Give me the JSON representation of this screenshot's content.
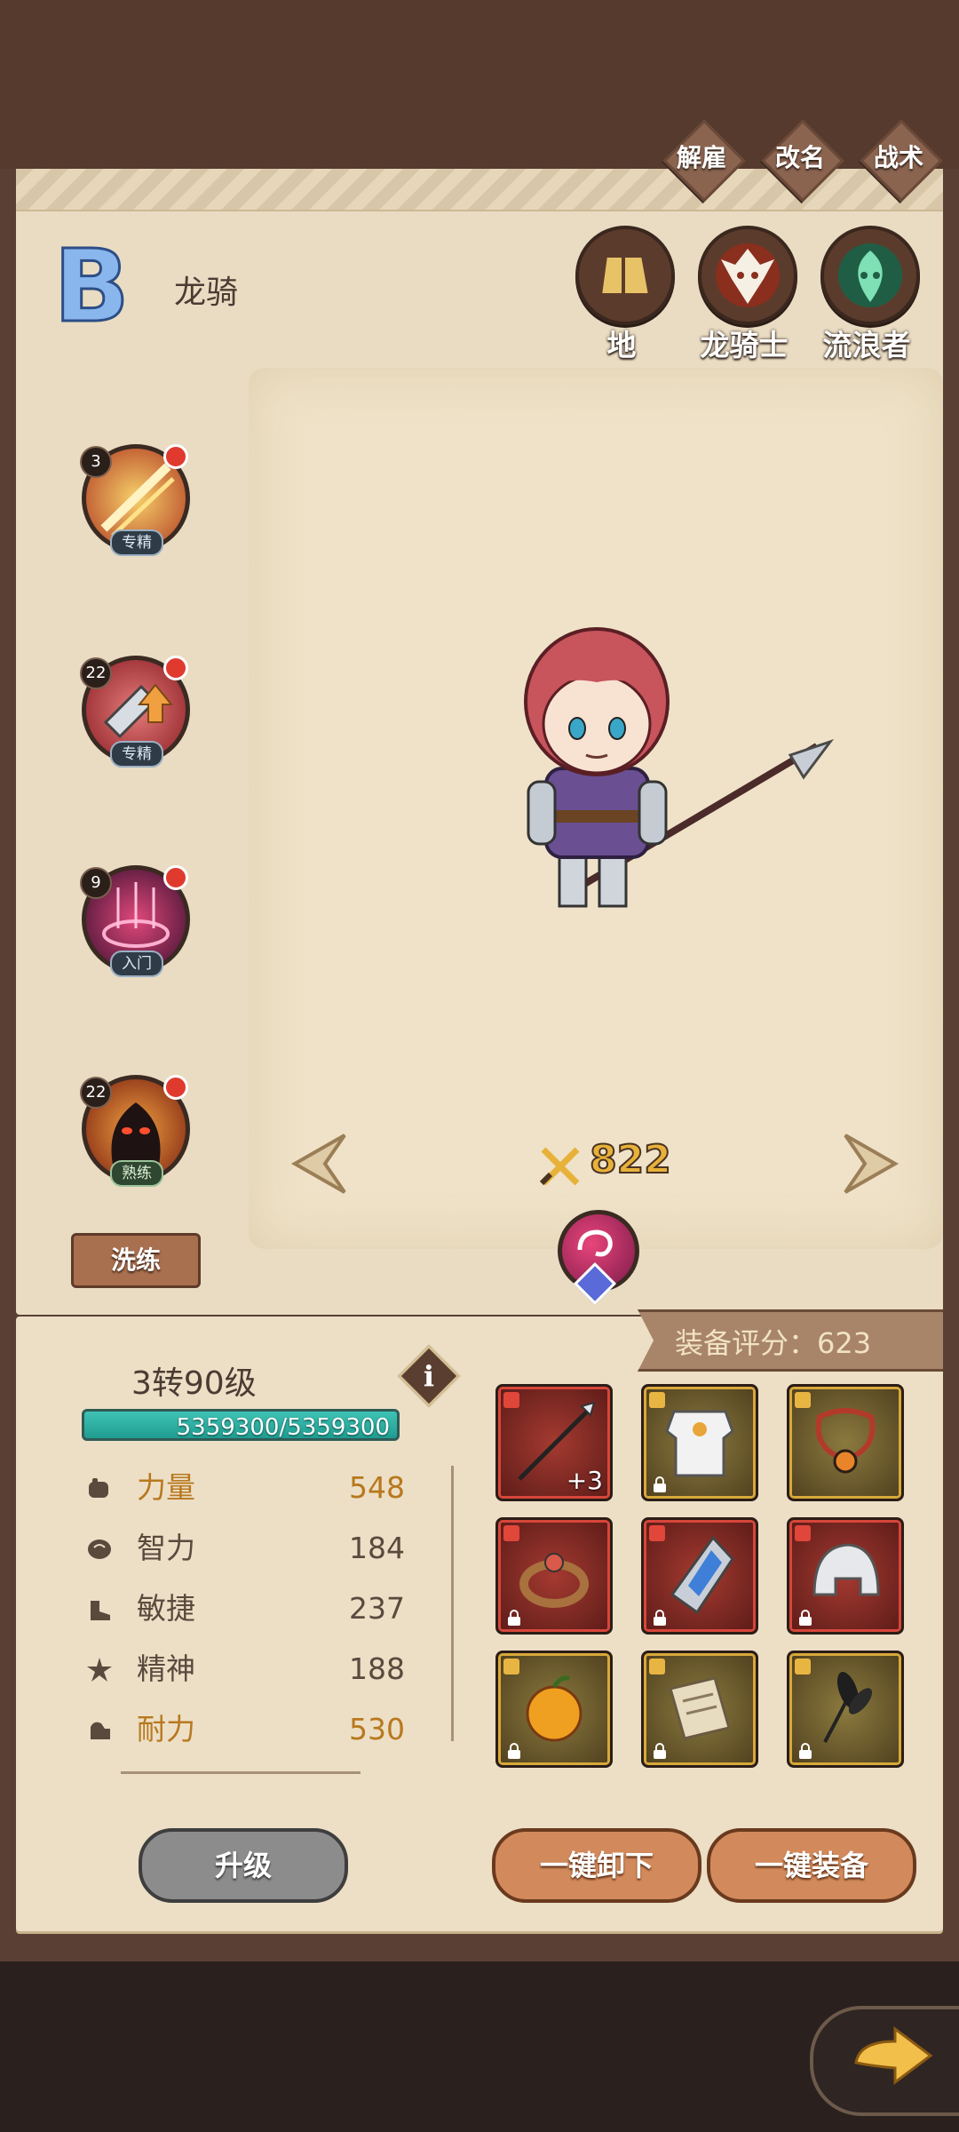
{
  "top_buttons": [
    "解雇",
    "改名",
    "战术"
  ],
  "hero": {
    "rank": "B",
    "name": "龙骑"
  },
  "classes": [
    {
      "label": "地",
      "icon": "earth-element-icon"
    },
    {
      "label": "龙骑士",
      "icon": "dragon-knight-icon"
    },
    {
      "label": "流浪者",
      "icon": "wanderer-icon"
    }
  ],
  "skills": [
    {
      "level": "3",
      "tag": "专精",
      "icon": "slash-skill-icon"
    },
    {
      "level": "22",
      "tag": "专精",
      "icon": "sword-upgrade-skill-icon"
    },
    {
      "level": "9",
      "tag": "入门",
      "icon": "magic-circle-skill-icon"
    },
    {
      "level": "22",
      "tag": "熟练",
      "icon": "fire-demon-skill-icon"
    }
  ],
  "refine_label": "洗练",
  "power": "822",
  "equipment_score": "装备评分：623",
  "level_text": "3转90级",
  "hp_text": "5359300/5359300",
  "stats": [
    {
      "name": "力量",
      "value": "548",
      "highlight": true
    },
    {
      "name": "智力",
      "value": "184",
      "highlight": false
    },
    {
      "name": "敏捷",
      "value": "237",
      "highlight": false
    },
    {
      "name": "精神",
      "value": "188",
      "highlight": false
    },
    {
      "name": "耐力",
      "value": "530",
      "highlight": true
    }
  ],
  "equipment": [
    {
      "name": "spear-item-icon",
      "rarity": "red",
      "enhance": "+3",
      "locked": false
    },
    {
      "name": "white-armor-item-icon",
      "rarity": "gold",
      "enhance": "",
      "locked": true
    },
    {
      "name": "necklace-item-icon",
      "rarity": "gold",
      "enhance": "",
      "locked": false
    },
    {
      "name": "ring-item-icon",
      "rarity": "red",
      "enhance": "",
      "locked": true
    },
    {
      "name": "blue-gem-shield-item-icon",
      "rarity": "red",
      "enhance": "",
      "locked": true
    },
    {
      "name": "helmet-item-icon",
      "rarity": "red",
      "enhance": "",
      "locked": true
    },
    {
      "name": "golden-apple-item-icon",
      "rarity": "gold",
      "enhance": "",
      "locked": true
    },
    {
      "name": "scroll-item-icon",
      "rarity": "gold",
      "enhance": "",
      "locked": true
    },
    {
      "name": "black-flower-item-icon",
      "rarity": "gold",
      "enhance": "",
      "locked": true
    }
  ],
  "buttons": {
    "upgrade": "升级",
    "unequip_all": "一键卸下",
    "equip_all": "一键装备"
  },
  "colors": {
    "stat_highlight": "#b8781e",
    "stat_normal": "#5a4a3e"
  }
}
